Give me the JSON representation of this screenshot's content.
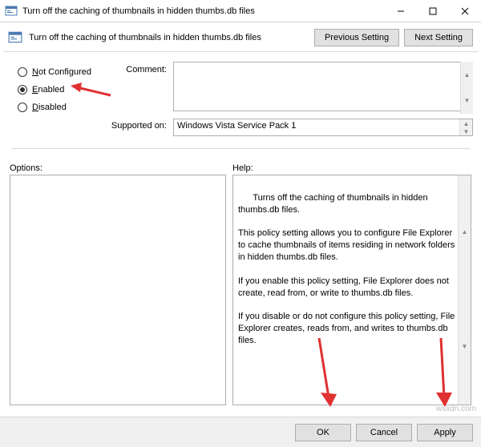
{
  "window": {
    "title": "Turn off the caching of thumbnails in hidden thumbs.db files"
  },
  "header": {
    "subtitle": "Turn off the caching of thumbnails in hidden thumbs.db files",
    "prev": "Previous Setting",
    "next": "Next Setting"
  },
  "radios": {
    "not_configured": "Not Configured",
    "enabled": "Enabled",
    "disabled": "Disabled",
    "selected": "enabled"
  },
  "labels": {
    "comment": "Comment:",
    "supported": "Supported on:",
    "options": "Options:",
    "help": "Help:"
  },
  "fields": {
    "comment_value": "",
    "supported_value": "Windows Vista Service Pack 1"
  },
  "help_text": "Turns off the caching of thumbnails in hidden thumbs.db files.\n\nThis policy setting allows you to configure File Explorer to cache thumbnails of items residing in network folders in hidden thumbs.db files.\n\nIf you enable this policy setting, File Explorer does not create, read from, or write to thumbs.db files.\n\nIf you disable or do not configure this policy setting, File Explorer creates, reads from, and writes to thumbs.db files.",
  "buttons": {
    "ok": "OK",
    "cancel": "Cancel",
    "apply": "Apply"
  },
  "watermark": "wsxdn.com"
}
